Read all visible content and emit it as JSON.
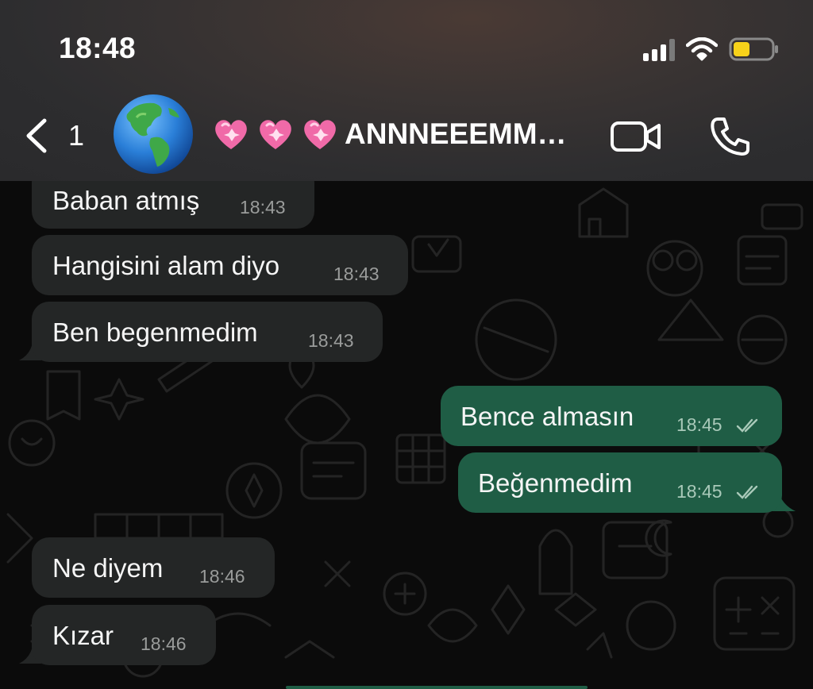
{
  "status_bar": {
    "time": "18:48",
    "battery_level": 0.3,
    "battery_color": "#f7d21a",
    "signal_bars_active": 3
  },
  "nav": {
    "back_icon": "chevron-left-icon",
    "unread_count": "1",
    "avatar": "globe-americas-emoji",
    "contact_name": "ANNNEEEMM…",
    "name_prefix_emoji": [
      "pink-heart",
      "pink-heart",
      "pink-heart"
    ],
    "video_icon": "video-camera-icon",
    "call_icon": "phone-icon"
  },
  "colors": {
    "incoming_bubble": "#242626",
    "outgoing_bubble": "#1f5d45",
    "background": "#0b0b0b"
  },
  "messages": [
    {
      "direction": "incoming",
      "text": "Baban atmış",
      "time": "18:43"
    },
    {
      "direction": "incoming",
      "text": "Hangisini alam diyo",
      "time": "18:43"
    },
    {
      "direction": "incoming",
      "text": "Ben begenmedim",
      "time": "18:43"
    },
    {
      "direction": "outgoing",
      "text": "Bence almasın",
      "time": "18:45",
      "read": true
    },
    {
      "direction": "outgoing",
      "text": "Beğenmedim",
      "time": "18:45",
      "read": true
    },
    {
      "direction": "incoming",
      "text": "Ne diyem",
      "time": "18:46"
    },
    {
      "direction": "incoming",
      "text": "Kızar",
      "time": "18:46"
    }
  ]
}
